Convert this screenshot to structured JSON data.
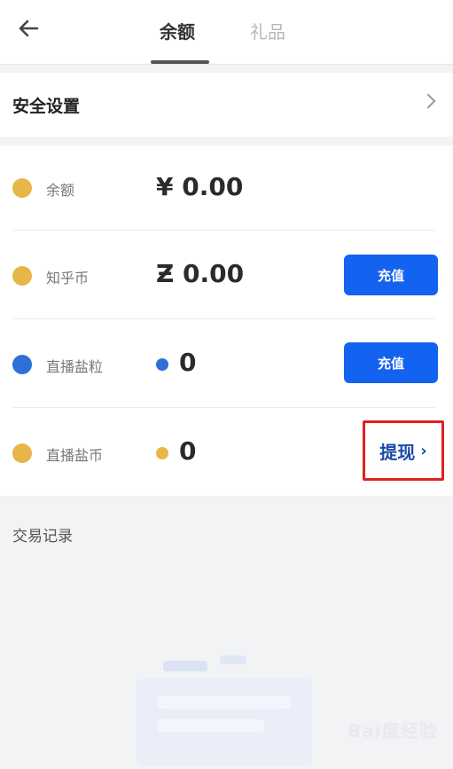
{
  "header": {
    "tabs": [
      {
        "label": "余额",
        "active": true
      },
      {
        "label": "礼品",
        "active": false
      }
    ]
  },
  "security": {
    "label": "安全设置"
  },
  "wallet": {
    "rows": [
      {
        "label": "余额",
        "amount": "¥ 0.00",
        "coin_color": "#e7b54a"
      },
      {
        "label": "知乎币",
        "amount": "Ƶ 0.00",
        "button": "充值",
        "coin_color": "#e7b54a"
      },
      {
        "label": "直播盐粒",
        "amount": "0",
        "button": "充值",
        "coin_color": "#2f6fd8"
      },
      {
        "label": "直播盐币",
        "amount": "0",
        "action": "提现",
        "coin_color": "#e7b54a"
      }
    ]
  },
  "transactions": {
    "label": "交易记录"
  },
  "watermark": "Bai度经验",
  "colors": {
    "accent_blue": "#1463f0",
    "highlight_red": "#e02020"
  }
}
